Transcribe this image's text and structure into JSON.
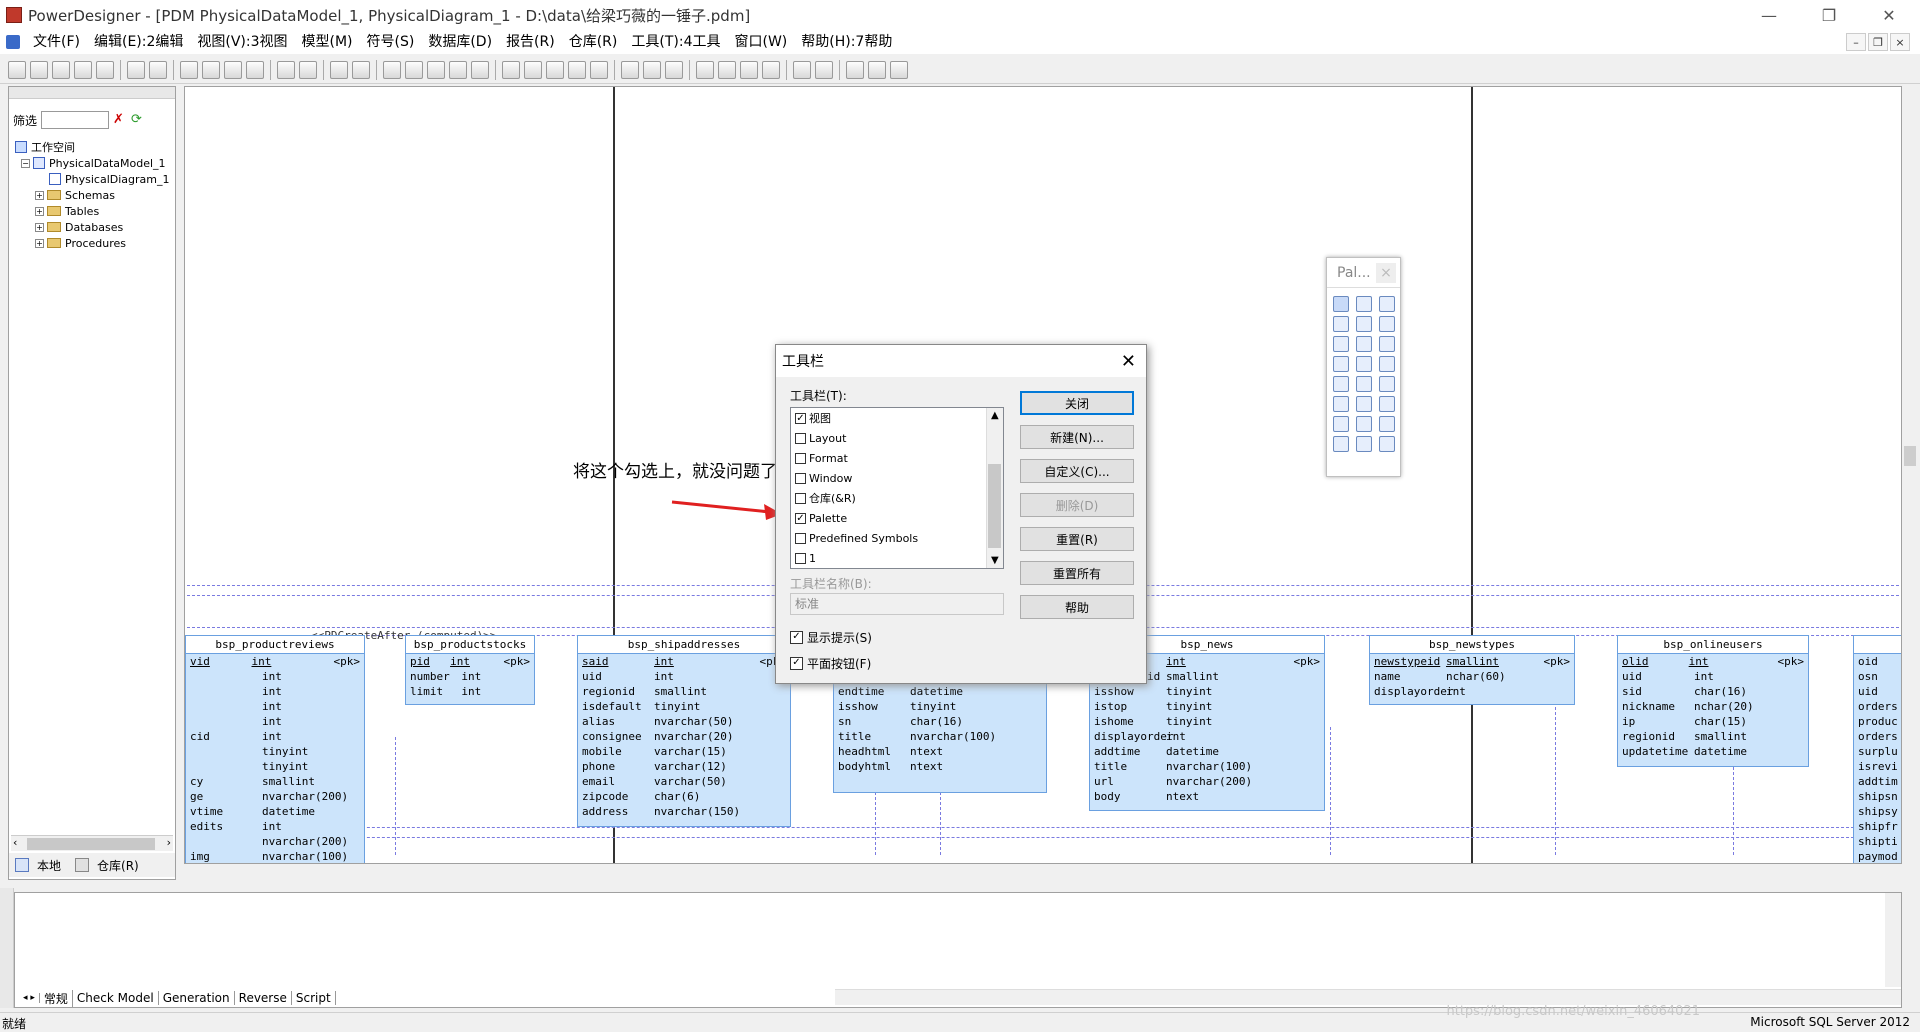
{
  "window": {
    "title": "PowerDesigner - [PDM PhysicalDataModel_1, PhysicalDiagram_1 - D:\\data\\给梁巧薇的一锤子.pdm]"
  },
  "menu": [
    "文件(F)",
    "编辑(E):2编辑",
    "视图(V):3视图",
    "模型(M)",
    "符号(S)",
    "数据库(D)",
    "报告(R)",
    "仓库(R)",
    "工具(T):4工具",
    "窗口(W)",
    "帮助(H):7帮助"
  ],
  "browser": {
    "filter_label": "筛选",
    "tree": [
      "工作空间",
      "PhysicalDataModel_1",
      "PhysicalDiagram_1",
      "Schemas",
      "Tables",
      "Databases",
      "Procedures"
    ],
    "tabs": [
      "本地",
      "仓库(R)"
    ]
  },
  "palette": {
    "title": "Pal..."
  },
  "dialog": {
    "title": "工具栏",
    "list_label": "工具栏(T):",
    "items": [
      {
        "label": "视图",
        "checked": true
      },
      {
        "label": "Layout",
        "checked": false
      },
      {
        "label": "Format",
        "checked": false
      },
      {
        "label": "Window",
        "checked": false
      },
      {
        "label": "仓库(&R)",
        "checked": false
      },
      {
        "label": "Palette",
        "checked": true
      },
      {
        "label": "Predefined Symbols",
        "checked": false
      },
      {
        "label": "1",
        "checked": false
      }
    ],
    "buttons": [
      "关闭",
      "新建(N)...",
      "自定义(C)...",
      "删除(D)",
      "重置(R)",
      "重置所有",
      "帮助"
    ],
    "name_label": "工具栏名称(B):",
    "name_value": "标准",
    "show_tips": "显示提示(S)",
    "flat_buttons": "平面按钮(F)"
  },
  "annotation": "将这个勾选上，就没问题了",
  "diagram": {
    "top_text": "<<PDCreateAfter (computed)>>",
    "tables": [
      {
        "name": "bsp_productreviews",
        "rows": [
          [
            "vid",
            "int",
            "<pk>"
          ],
          [
            "",
            "int",
            ""
          ],
          [
            "",
            "int",
            ""
          ],
          [
            "",
            "int",
            ""
          ],
          [
            "",
            "int",
            ""
          ],
          [
            "cid",
            "int",
            ""
          ],
          [
            "",
            "tinyint",
            ""
          ],
          [
            "",
            "tinyint",
            ""
          ],
          [
            "cy",
            "smallint",
            ""
          ],
          [
            "ge",
            "nvarchar(200)",
            ""
          ],
          [
            "vtime",
            "datetime",
            ""
          ],
          [
            "edits",
            "int",
            ""
          ],
          [
            "",
            "nvarchar(200)",
            ""
          ],
          [
            "img",
            "nvarchar(100)",
            ""
          ]
        ]
      },
      {
        "name": "bsp_productstocks",
        "rows": [
          [
            "pid",
            "int",
            "<pk>"
          ],
          [
            "number",
            "int",
            ""
          ],
          [
            "limit",
            "int",
            ""
          ]
        ]
      },
      {
        "name": "bsp_shipaddresses",
        "rows": [
          [
            "said",
            "int",
            "<pk>"
          ],
          [
            "uid",
            "int",
            ""
          ],
          [
            "regionid",
            "smallint",
            ""
          ],
          [
            "isdefault",
            "tinyint",
            ""
          ],
          [
            "alias",
            "nvarchar(50)",
            ""
          ],
          [
            "consignee",
            "nvarchar(20)",
            ""
          ],
          [
            "mobile",
            "varchar(15)",
            ""
          ],
          [
            "phone",
            "varchar(12)",
            ""
          ],
          [
            "email",
            "varchar(50)",
            ""
          ],
          [
            "zipcode",
            "char(6)",
            ""
          ],
          [
            "address",
            "nvarchar(150)",
            ""
          ]
        ]
      },
      {
        "name": "",
        "rows": [
          [
            "endtime",
            "datetime",
            ""
          ],
          [
            "isshow",
            "tinyint",
            ""
          ],
          [
            "sn",
            "char(16)",
            ""
          ],
          [
            "title",
            "nvarchar(100)",
            ""
          ],
          [
            "headhtml",
            "ntext",
            ""
          ],
          [
            "bodyhtml",
            "ntext",
            ""
          ]
        ]
      },
      {
        "name": "bsp_news",
        "rows": [
          [
            "",
            "int",
            "<pk>"
          ],
          [
            "newstypeid",
            "smallint",
            ""
          ],
          [
            "isshow",
            "tinyint",
            ""
          ],
          [
            "istop",
            "tinyint",
            ""
          ],
          [
            "ishome",
            "tinyint",
            ""
          ],
          [
            "displayorder",
            "int",
            ""
          ],
          [
            "addtime",
            "datetime",
            ""
          ],
          [
            "title",
            "nvarchar(100)",
            ""
          ],
          [
            "url",
            "nvarchar(200)",
            ""
          ],
          [
            "body",
            "ntext",
            ""
          ]
        ]
      },
      {
        "name": "bsp_newstypes",
        "rows": [
          [
            "newstypeid",
            "smallint",
            "<pk>"
          ],
          [
            "name",
            "nchar(60)",
            ""
          ],
          [
            "displayorder",
            "int",
            ""
          ]
        ]
      },
      {
        "name": "bsp_onlineusers",
        "rows": [
          [
            "olid",
            "int",
            "<pk>"
          ],
          [
            "uid",
            "int",
            ""
          ],
          [
            "sid",
            "char(16)",
            ""
          ],
          [
            "nickname",
            "nchar(20)",
            ""
          ],
          [
            "ip",
            "char(15)",
            ""
          ],
          [
            "regionid",
            "smallint",
            ""
          ],
          [
            "updatetime",
            "datetime",
            ""
          ]
        ]
      },
      {
        "name": "",
        "rows": [
          [
            "oid",
            "",
            ""
          ],
          [
            "osn",
            "",
            ""
          ],
          [
            "uid",
            "",
            ""
          ],
          [
            "orders",
            "",
            ""
          ],
          [
            "produc",
            "",
            ""
          ],
          [
            "orders",
            "",
            ""
          ],
          [
            "surplu",
            "",
            ""
          ],
          [
            "isrevi",
            "",
            ""
          ],
          [
            "addtim",
            "",
            ""
          ],
          [
            "shipsn",
            "",
            ""
          ],
          [
            "shipsy",
            "",
            ""
          ],
          [
            "shipfr",
            "",
            ""
          ],
          [
            "shipti",
            "",
            ""
          ],
          [
            "paymod",
            "",
            ""
          ]
        ]
      }
    ]
  },
  "output_tabs": [
    "常规",
    "Check Model",
    "Generation",
    "Reverse",
    "Script"
  ],
  "status": {
    "left": "就绪",
    "right": "Microsoft SQL Server 2012"
  },
  "watermark": "https://blog.csdn.net/weixin_46064021"
}
